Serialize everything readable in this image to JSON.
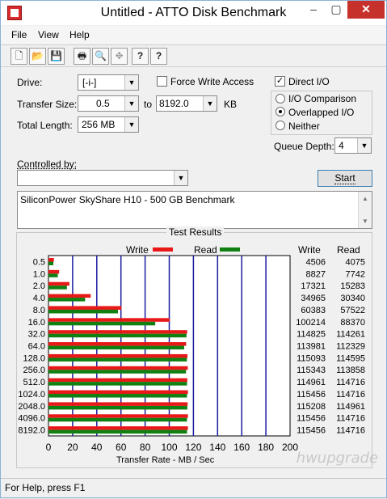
{
  "window": {
    "title": "Untitled - ATTO Disk Benchmark",
    "controls": [
      "–",
      "▢",
      "✕"
    ]
  },
  "menu": [
    "File",
    "View",
    "Help"
  ],
  "toolbar": {
    "icons": [
      "new-file-icon",
      "open-folder-icon",
      "save-icon",
      "print-icon",
      "print-preview-icon",
      "move-icon",
      "help-icon",
      "context-help-icon"
    ],
    "glyphs": [
      "🗋",
      "📂",
      "💾",
      "🖶",
      "🔍",
      "✥",
      "?",
      "?"
    ]
  },
  "settings": {
    "drive_label": "Drive:",
    "drive_value": "[-i-]",
    "transfer_size_label": "Transfer Size:",
    "transfer_from": "0.5",
    "to_label": "to",
    "transfer_to": "8192.0",
    "kb_label": "KB",
    "total_length_label": "Total Length:",
    "total_length_value": "256 MB",
    "force_write_label": "Force Write Access",
    "direct_io_label": "Direct I/O",
    "io_comparison_label": "I/O Comparison",
    "overlapped_io_label": "Overlapped I/O",
    "neither_label": "Neither",
    "queue_depth_label": "Queue Depth:",
    "queue_depth_value": "4",
    "controlled_by_label": "Controlled by:",
    "controlled_by_value": "",
    "start_label": "Start",
    "description": "SiliconPower SkyShare H10 - 500 GB Benchmark",
    "force_write_checked": false,
    "direct_io_checked": true,
    "selected_mode": "overlapped"
  },
  "results": {
    "title": "Test Results",
    "write_legend": "Write",
    "read_legend": "Read",
    "write_header": "Write",
    "read_header": "Read",
    "x_axis_label": "Transfer Rate - MB / Sec",
    "colors": {
      "write": "#e81818",
      "read": "#108010",
      "grid": "#1c1c9e"
    }
  },
  "chart_data": {
    "type": "bar",
    "title": "Test Results",
    "xlabel": "Transfer Rate - MB / Sec",
    "ylabel": "",
    "categories": [
      "0.5",
      "1.0",
      "2.0",
      "4.0",
      "8.0",
      "16.0",
      "32.0",
      "64.0",
      "128.0",
      "256.0",
      "512.0",
      "1024.0",
      "2048.0",
      "4096.0",
      "8192.0"
    ],
    "series": [
      {
        "name": "Write",
        "values": [
          4506,
          8827,
          17321,
          34965,
          60383,
          100214,
          114825,
          113981,
          115093,
          115343,
          114961,
          115456,
          115208,
          115456,
          115456
        ]
      },
      {
        "name": "Read",
        "values": [
          4075,
          7742,
          15283,
          30340,
          57522,
          88370,
          114261,
          112329,
          114595,
          113858,
          114716,
          114716,
          114961,
          114716,
          114716
        ]
      }
    ],
    "xticks": [
      "0",
      "20",
      "40",
      "60",
      "80",
      "100",
      "120",
      "140",
      "160",
      "180",
      "200"
    ],
    "xlim": [
      0,
      200
    ]
  },
  "status": {
    "text": "For Help, press F1"
  },
  "watermark": "hwupgrade"
}
